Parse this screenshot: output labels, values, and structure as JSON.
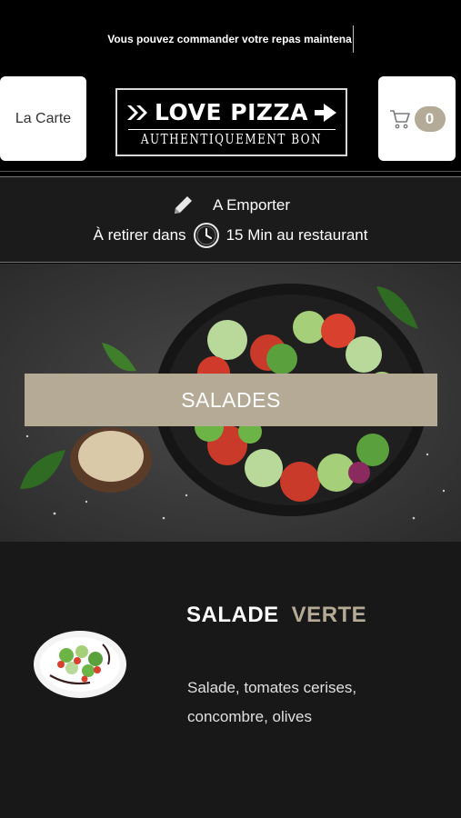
{
  "marquee": {
    "text": "Vous pouvez commander votre repas maintena"
  },
  "header": {
    "menu_label": "La Carte",
    "cart_count": "0",
    "logo_title": "LOVE PIZZA",
    "logo_subtitle": "AUTHENTIQUEMENT BON"
  },
  "pickup": {
    "mode_label": "A Emporter",
    "prefix": "À retirer dans",
    "time": "15 Min au restaurant"
  },
  "category": {
    "title": "SALADES"
  },
  "product": {
    "title_word1": "SALADE",
    "title_word2": "VERTE",
    "description": "Salade, tomates cerises, concombre, olives"
  },
  "colors": {
    "accent": "#b4aa96",
    "background": "#000000",
    "panel": "#1b1b1b"
  },
  "icons": {
    "cart": "cart-icon",
    "pencil": "pencil-icon",
    "clock": "clock-icon",
    "logo_arrows": "double-chevron-icon"
  }
}
